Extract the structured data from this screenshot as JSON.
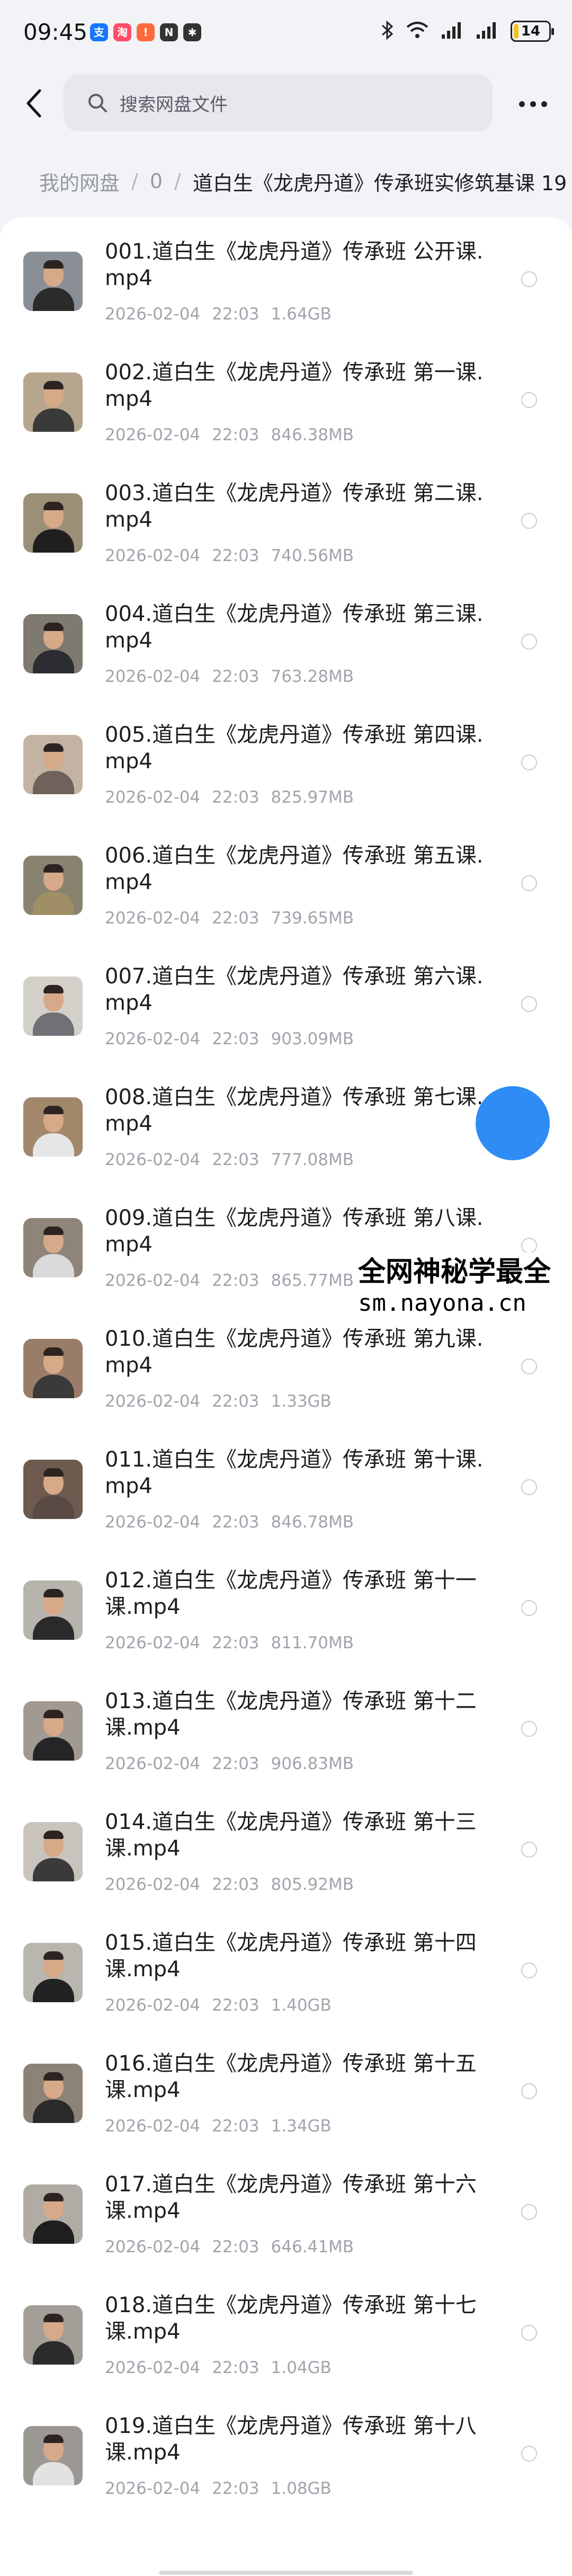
{
  "status_bar": {
    "time": "09:45",
    "app_icons": [
      {
        "name": "alipay-icon",
        "glyph": "支",
        "color": "#1677ff"
      },
      {
        "name": "app-notification-icon",
        "glyph": "淘",
        "color": "#ff4d6a"
      },
      {
        "name": "alert-app-icon",
        "glyph": "!",
        "color": "#ff6a3d"
      },
      {
        "name": "nfc-icon",
        "glyph": "N",
        "color": "#333333"
      },
      {
        "name": "bug-icon",
        "glyph": "✱",
        "color": "#333333"
      }
    ],
    "battery_level": "14",
    "battery_fraction": 0.14
  },
  "header": {
    "search_placeholder": "搜索网盘文件"
  },
  "breadcrumb": {
    "root": "我的网盘",
    "separator": "/",
    "level1": "0",
    "current": "道白生《龙虎丹道》传承班实修筑基课 19"
  },
  "files": [
    {
      "name": "001.道白生《龙虎丹道》传承班 公开课.mp4",
      "date": "2026-02-04",
      "time": "22:03",
      "size": "1.64GB",
      "shirt": "#2b2b2b",
      "bg": "#8a8f96"
    },
    {
      "name": "002.道白生《龙虎丹道》传承班 第一课.mp4",
      "date": "2026-02-04",
      "time": "22:03",
      "size": "846.38MB",
      "shirt": "#3a3a3a",
      "bg": "#b6a68e"
    },
    {
      "name": "003.道白生《龙虎丹道》传承班 第二课.mp4",
      "date": "2026-02-04",
      "time": "22:03",
      "size": "740.56MB",
      "shirt": "#1f1f1f",
      "bg": "#9c8f78"
    },
    {
      "name": "004.道白生《龙虎丹道》传承班 第三课.mp4",
      "date": "2026-02-04",
      "time": "22:03",
      "size": "763.28MB",
      "shirt": "#2c2c33",
      "bg": "#7f7a70"
    },
    {
      "name": "005.道白生《龙虎丹道》传承班 第四课.mp4",
      "date": "2026-02-04",
      "time": "22:03",
      "size": "825.97MB",
      "shirt": "#6f625a",
      "bg": "#c2b3a3"
    },
    {
      "name": "006.道白生《龙虎丹道》传承班 第五课.mp4",
      "date": "2026-02-04",
      "time": "22:03",
      "size": "739.65MB",
      "shirt": "#a08f66",
      "bg": "#88836e"
    },
    {
      "name": "007.道白生《龙虎丹道》传承班 第六课.mp4",
      "date": "2026-02-04",
      "time": "22:03",
      "size": "903.09MB",
      "shirt": "#6f7176",
      "bg": "#d3d0ca"
    },
    {
      "name": "008.道白生《龙虎丹道》传承班 第七课.mp4",
      "date": "2026-02-04",
      "time": "22:03",
      "size": "777.08MB",
      "shirt": "#e6e6e6",
      "bg": "#a2876b"
    },
    {
      "name": "009.道白生《龙虎丹道》传承班 第八课.mp4",
      "date": "2026-02-04",
      "time": "22:03",
      "size": "865.77MB",
      "shirt": "#d9d9d9",
      "bg": "#8e8478"
    },
    {
      "name": "010.道白生《龙虎丹道》传承班 第九课.mp4",
      "date": "2026-02-04",
      "time": "22:03",
      "size": "1.33GB",
      "shirt": "#3a3a3a",
      "bg": "#9a7d68"
    },
    {
      "name": "011.道白生《龙虎丹道》传承班 第十课.mp4",
      "date": "2026-02-04",
      "time": "22:03",
      "size": "846.78MB",
      "shirt": "#5a4a44",
      "bg": "#6e5a4f"
    },
    {
      "name": "012.道白生《龙虎丹道》传承班 第十一课.mp4",
      "date": "2026-02-04",
      "time": "22:03",
      "size": "811.70MB",
      "shirt": "#2a2a2a",
      "bg": "#b7b3ad"
    },
    {
      "name": "013.道白生《龙虎丹道》传承班 第十二课.mp4",
      "date": "2026-02-04",
      "time": "22:03",
      "size": "906.83MB",
      "shirt": "#252525",
      "bg": "#a09a92"
    },
    {
      "name": "014.道白生《龙虎丹道》传承班 第十三课.mp4",
      "date": "2026-02-04",
      "time": "22:03",
      "size": "805.92MB",
      "shirt": "#3a3a3a",
      "bg": "#c8c4bd"
    },
    {
      "name": "015.道白生《龙虎丹道》传承班 第十四课.mp4",
      "date": "2026-02-04",
      "time": "22:03",
      "size": "1.40GB",
      "shirt": "#222222",
      "bg": "#b9b5af"
    },
    {
      "name": "016.道白生《龙虎丹道》传承班 第十五课.mp4",
      "date": "2026-02-04",
      "time": "22:03",
      "size": "1.34GB",
      "shirt": "#2a2a2a",
      "bg": "#8d8276"
    },
    {
      "name": "017.道白生《龙虎丹道》传承班 第十六课.mp4",
      "date": "2026-02-04",
      "time": "22:03",
      "size": "646.41MB",
      "shirt": "#1e1e1e",
      "bg": "#b0aba4"
    },
    {
      "name": "018.道白生《龙虎丹道》传承班 第十七课.mp4",
      "date": "2026-02-04",
      "time": "22:03",
      "size": "1.04GB",
      "shirt": "#2b2b2b",
      "bg": "#a39e97"
    },
    {
      "name": "019.道白生《龙虎丹道》传承班 第十八课.mp4",
      "date": "2026-02-04",
      "time": "22:03",
      "size": "1.08GB",
      "shirt": "#e2e2e2",
      "bg": "#9b9893"
    }
  ],
  "watermark": {
    "line1": "全网神秘学最全",
    "line2": "sm.nayona.cn"
  },
  "colors": {
    "accent": "#2f8cf4",
    "background": "#f2f3f7",
    "panel": "#ffffff",
    "meta_text": "#a2a4ac"
  }
}
